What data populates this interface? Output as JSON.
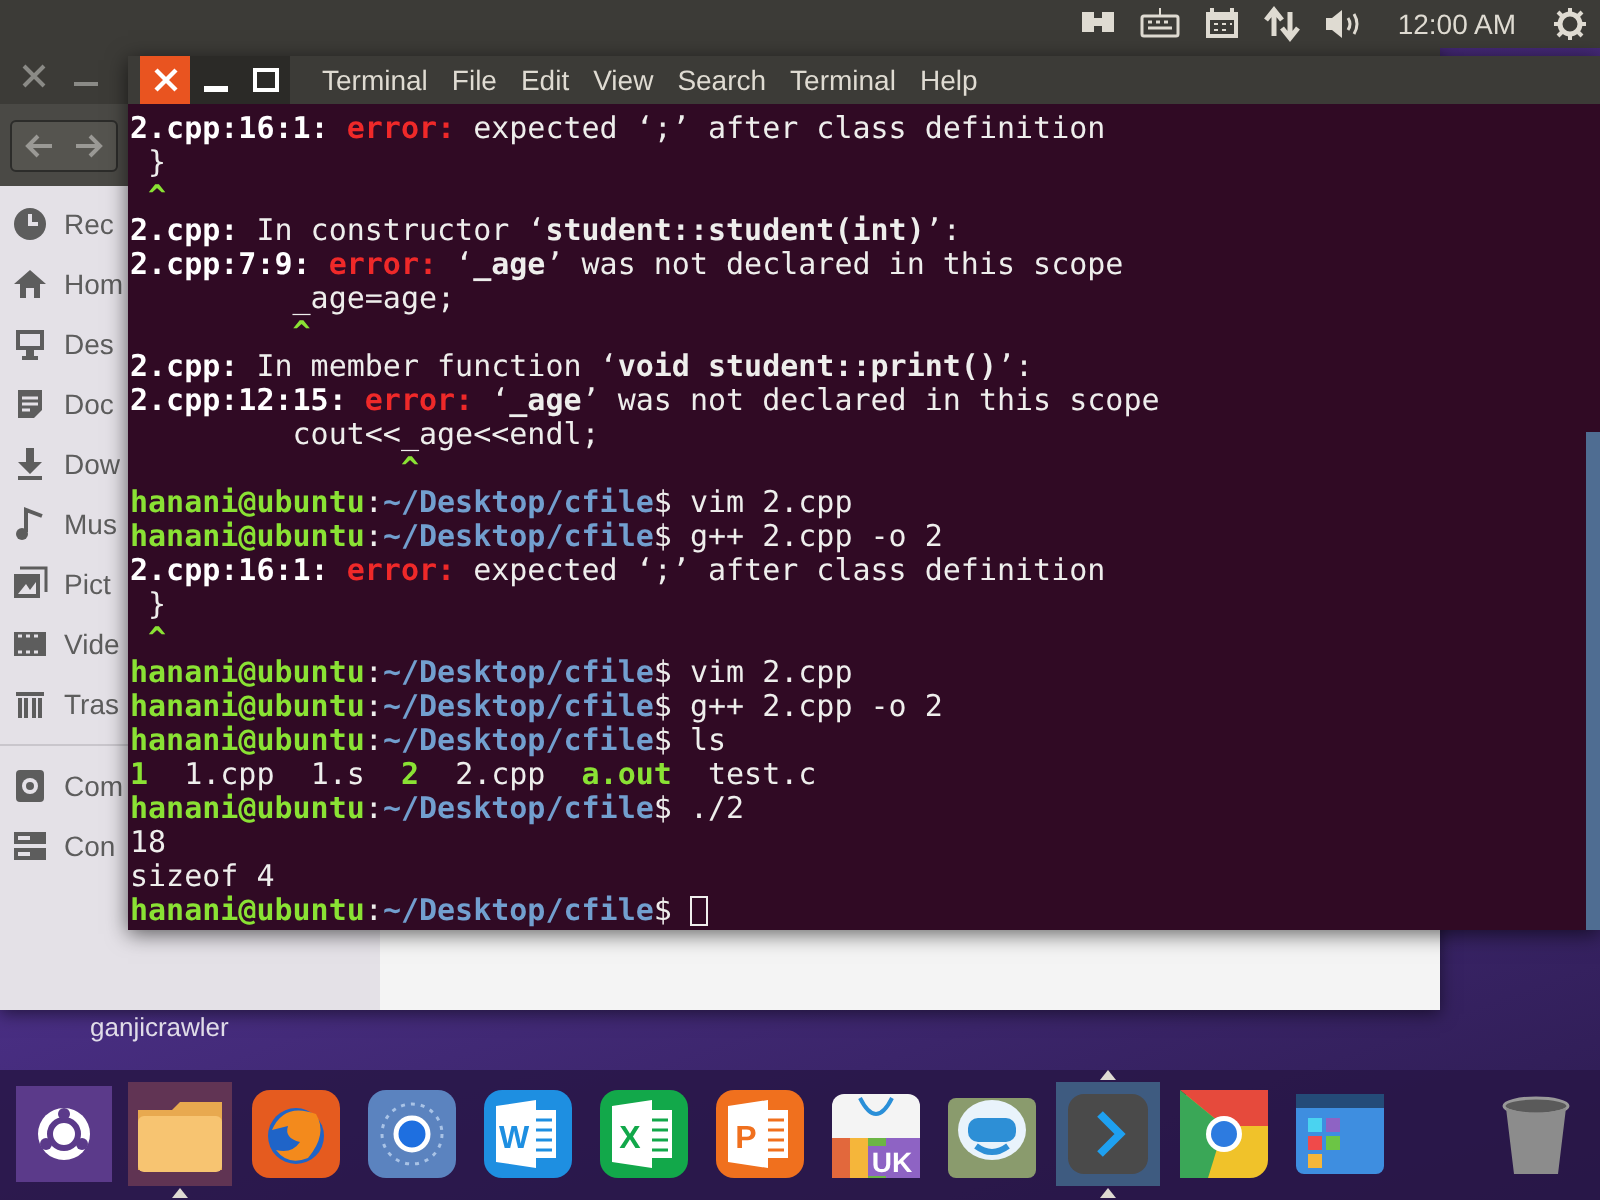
{
  "top_panel": {
    "clock": "12:00 AM",
    "indicators": [
      {
        "kind": "battery"
      },
      {
        "kind": "keyboard"
      },
      {
        "kind": "calendar"
      },
      {
        "kind": "network"
      },
      {
        "kind": "volume"
      },
      {
        "kind": "power"
      }
    ]
  },
  "file_manager": {
    "sidebar": {
      "items": [
        {
          "kind": "recent",
          "label": "Rec"
        },
        {
          "kind": "home",
          "label": "Hom"
        },
        {
          "kind": "desktop",
          "label": "Des"
        },
        {
          "kind": "documents",
          "label": "Doc"
        },
        {
          "kind": "downloads",
          "label": "Dow"
        },
        {
          "kind": "music",
          "label": "Mus"
        },
        {
          "kind": "pictures",
          "label": "Pict"
        },
        {
          "kind": "videos",
          "label": "Vide"
        },
        {
          "kind": "trash",
          "label": "Tras"
        }
      ],
      "network_items": [
        {
          "kind": "computer",
          "label": "Com"
        },
        {
          "kind": "network",
          "label": "Con"
        }
      ]
    }
  },
  "desktop_icons": [
    {
      "label": "ganjicrawler"
    }
  ],
  "terminal": {
    "menu": [
      "Terminal",
      "File",
      "Edit",
      "View",
      "Search",
      "Terminal",
      "Help"
    ],
    "cursor_visible": true,
    "lines": [
      {
        "kind": "diagnostic",
        "location": "2.cpp:16:1:",
        "severity": "error:",
        "message": "expected ‘;’ after class definition"
      },
      {
        "kind": "source",
        "text": " }"
      },
      {
        "kind": "caret",
        "text": " ^"
      },
      {
        "kind": "context",
        "location": "2.cpp:",
        "message": "In constructor ‘**student::student(int)**’:"
      },
      {
        "kind": "diagnostic",
        "location": "2.cpp:7:9:",
        "severity": "error:",
        "message": "‘**_age**’ was not declared in this scope"
      },
      {
        "kind": "source",
        "text": "         _age=age;"
      },
      {
        "kind": "caret",
        "text": "         ^"
      },
      {
        "kind": "context",
        "location": "2.cpp:",
        "message": "In member function ‘**void student::print()**’:"
      },
      {
        "kind": "diagnostic",
        "location": "2.cpp:12:15:",
        "severity": "error:",
        "message": "‘**_age**’ was not declared in this scope"
      },
      {
        "kind": "source",
        "text": "         cout<<_age<<endl;"
      },
      {
        "kind": "caret",
        "text": "               ^"
      },
      {
        "kind": "prompt",
        "user": "hanani@ubuntu",
        "separator": ":",
        "path": "~/Desktop/cfile",
        "command": "$ vim 2.cpp"
      },
      {
        "kind": "prompt",
        "user": "hanani@ubuntu",
        "separator": ":",
        "path": "~/Desktop/cfile",
        "command": "$ g++ 2.cpp -o 2"
      },
      {
        "kind": "diagnostic",
        "location": "2.cpp:16:1:",
        "severity": "error:",
        "message": "expected ‘;’ after class definition"
      },
      {
        "kind": "source",
        "text": " }"
      },
      {
        "kind": "caret",
        "text": " ^"
      },
      {
        "kind": "prompt",
        "user": "hanani@ubuntu",
        "separator": ":",
        "path": "~/Desktop/cfile",
        "command": "$ vim 2.cpp"
      },
      {
        "kind": "prompt",
        "user": "hanani@ubuntu",
        "separator": ":",
        "path": "~/Desktop/cfile",
        "command": "$ g++ 2.cpp -o 2"
      },
      {
        "kind": "prompt",
        "user": "hanani@ubuntu",
        "separator": ":",
        "path": "~/Desktop/cfile",
        "command": "$ ls"
      },
      {
        "kind": "listing",
        "entries": [
          {
            "name": "1",
            "executable": true
          },
          {
            "name": "1.cpp",
            "executable": false
          },
          {
            "name": "1.s",
            "executable": false
          },
          {
            "name": "2",
            "executable": true
          },
          {
            "name": "2.cpp",
            "executable": false
          },
          {
            "name": "a.out",
            "executable": true
          },
          {
            "name": "test.c",
            "executable": false
          }
        ]
      },
      {
        "kind": "prompt",
        "user": "hanani@ubuntu",
        "separator": ":",
        "path": "~/Desktop/cfile",
        "command": "$ ./2"
      },
      {
        "kind": "output",
        "text": "18"
      },
      {
        "kind": "output",
        "text": "sizeof 4"
      },
      {
        "kind": "prompt",
        "user": "hanani@ubuntu",
        "separator": ":",
        "path": "~/Desktop/cfile",
        "command": "$"
      }
    ]
  },
  "dock": [
    {
      "kind": "ubuntu",
      "running": false,
      "focused": false
    },
    {
      "kind": "files",
      "running": true,
      "focused": false
    },
    {
      "kind": "firefox",
      "running": false,
      "focused": false
    },
    {
      "kind": "browser",
      "running": false,
      "focused": false
    },
    {
      "kind": "word",
      "glyph": "W",
      "running": false,
      "focused": false
    },
    {
      "kind": "excel",
      "glyph": "X",
      "running": false,
      "focused": false
    },
    {
      "kind": "powerpoint",
      "glyph": "P",
      "running": false,
      "focused": false
    },
    {
      "kind": "store",
      "glyph": "UK",
      "running": false,
      "focused": false
    },
    {
      "kind": "robot",
      "running": false,
      "focused": false
    },
    {
      "kind": "terminal",
      "running": true,
      "focused": true
    },
    {
      "kind": "chrome",
      "running": false,
      "focused": false
    },
    {
      "kind": "apps",
      "running": false,
      "focused": false
    },
    {
      "kind": "trash",
      "running": false,
      "focused": false
    }
  ]
}
